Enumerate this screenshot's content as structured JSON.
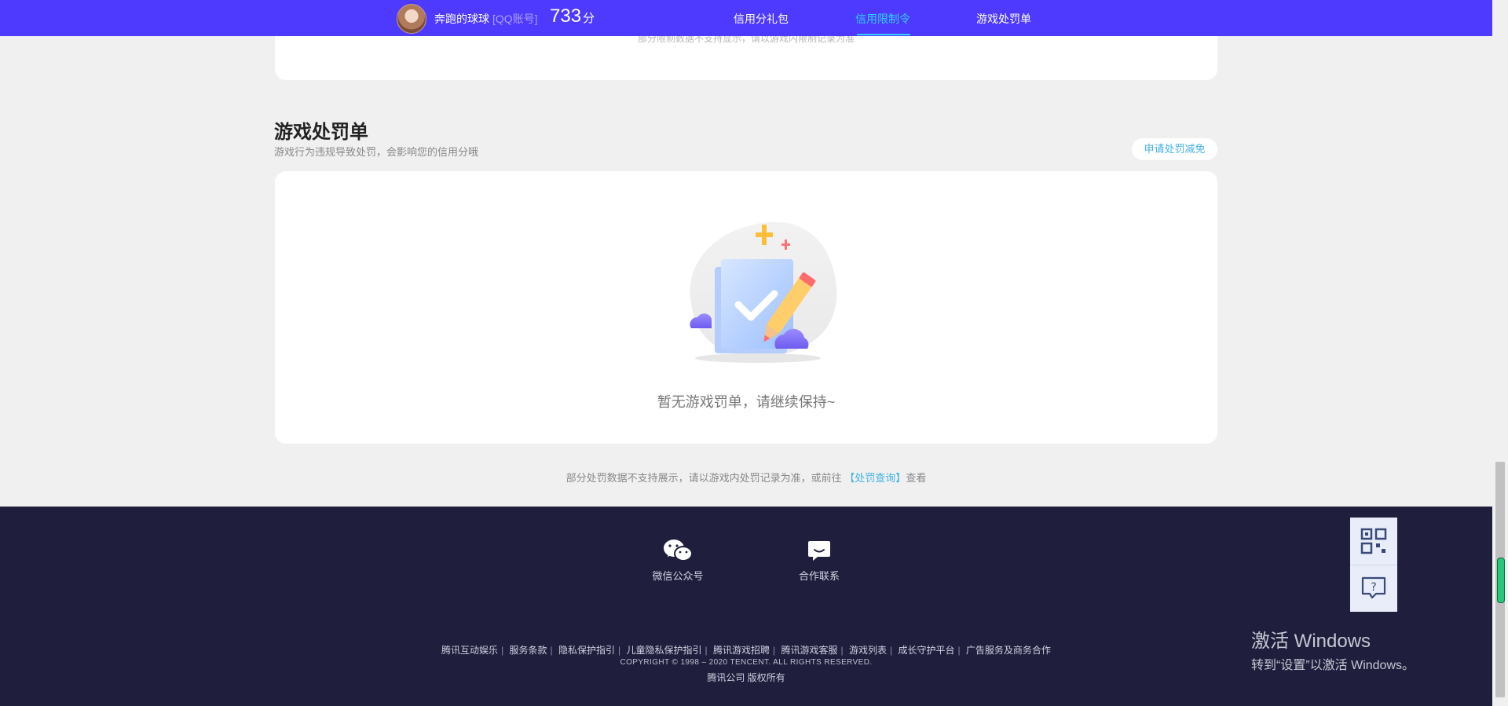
{
  "header": {
    "username": "奔跑的球球",
    "account_type": "[QQ账号]",
    "score": "733",
    "score_unit": "分",
    "nav": [
      {
        "label": "信用分礼包",
        "active": false
      },
      {
        "label": "信用限制令",
        "active": true
      },
      {
        "label": "游戏处罚单",
        "active": false
      }
    ]
  },
  "top_card": {
    "faded_note": "部分限制数据不支持显示，请以游戏内限制记录为准"
  },
  "section": {
    "title": "游戏处罚单",
    "subtitle": "游戏行为违规导致处罚，会影响您的信用分哦",
    "appeal_button": "申请处罚减免",
    "empty_text": "暂无游戏罚单，请继续保持~"
  },
  "page_note": {
    "before": "部分处罚数据不支持展示，请以游戏内处罚记录为准，或前往",
    "link": "【处罚查询】",
    "after": "查看"
  },
  "footer": {
    "wechat_label": "微信公众号",
    "contact_label": "合作联系",
    "links": [
      "腾讯互动娱乐",
      "服务条款",
      "隐私保护指引",
      "儿童隐私保护指引",
      "腾讯游戏招聘",
      "腾讯游戏客服",
      "游戏列表",
      "成长守护平台",
      "广告服务及商务合作"
    ],
    "copyright": "COPYRIGHT © 1998 – 2020 TENCENT. ALL RIGHTS RESERVED.",
    "company": "腾讯公司 版权所有"
  },
  "watermark": {
    "line1": "激活 Windows",
    "line2": "转到“设置”以激活 Windows。"
  },
  "colors": {
    "header_bg": "#4e39ff",
    "accent": "#2fd2ff",
    "link": "#3fb2e6",
    "footer_bg": "#1f1f3d"
  }
}
